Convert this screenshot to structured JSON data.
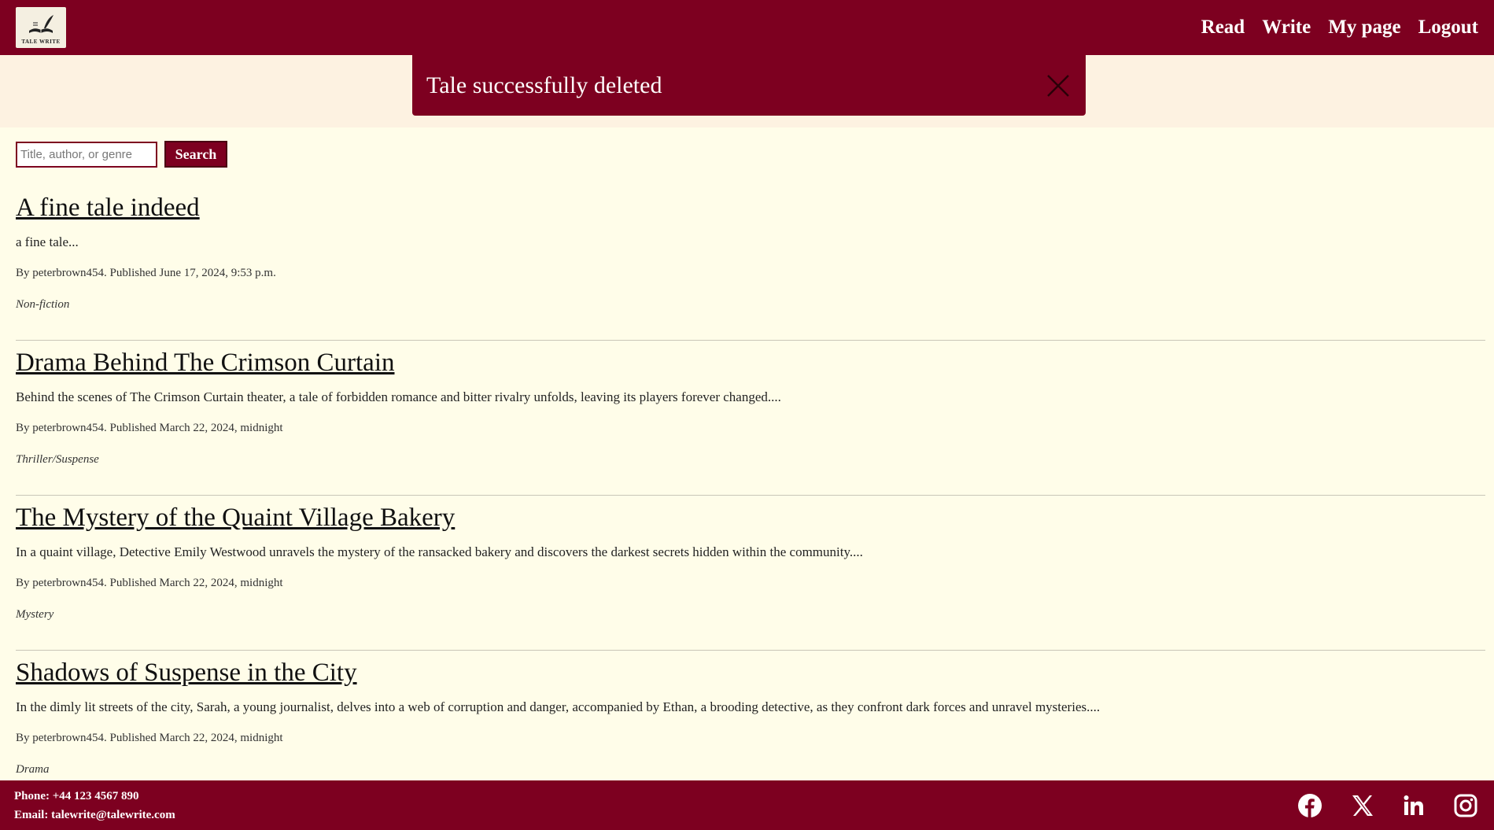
{
  "brand": {
    "logo_text": "TALE WRITE"
  },
  "nav": [
    {
      "label": "Read"
    },
    {
      "label": "Write"
    },
    {
      "label": "My page"
    },
    {
      "label": "Logout"
    }
  ],
  "alert": {
    "message": "Tale successfully deleted",
    "close_icon": "close-icon"
  },
  "search": {
    "placeholder": "Title, author, or genre",
    "button_label": "Search"
  },
  "tales": [
    {
      "title": "A fine tale indeed",
      "excerpt": "a fine tale...",
      "meta": "By peterbrown454. Published June 17, 2024, 9:53 p.m.",
      "genre": "Non-fiction"
    },
    {
      "title": "Drama Behind The Crimson Curtain",
      "excerpt": "Behind the scenes of The Crimson Curtain theater, a tale of forbidden romance and bitter rivalry unfolds, leaving its players forever changed....",
      "meta": "By peterbrown454. Published March 22, 2024, midnight",
      "genre": "Thriller/Suspense"
    },
    {
      "title": "The Mystery of the Quaint Village Bakery",
      "excerpt": "In a quaint village, Detective Emily Westwood unravels the mystery of the ransacked bakery and discovers the darkest secrets hidden within the community....",
      "meta": "By peterbrown454. Published March 22, 2024, midnight",
      "genre": "Mystery"
    },
    {
      "title": "Shadows of Suspense in the City",
      "excerpt": "In the dimly lit streets of the city, Sarah, a young journalist, delves into a web of corruption and danger, accompanied by Ethan, a brooding detective, as they confront dark forces and unravel mysteries....",
      "meta": "By peterbrown454. Published March 22, 2024, midnight",
      "genre": "Drama"
    }
  ],
  "footer": {
    "phone": "Phone: +44 123 4567 890",
    "email": "Email: talewrite@talewrite.com",
    "socials": [
      "facebook-icon",
      "x-icon",
      "linkedin-icon",
      "instagram-icon"
    ]
  },
  "colors": {
    "brand": "#7d0020",
    "page_bg": "#fffde9",
    "alert_band": "#fdf2e1"
  }
}
